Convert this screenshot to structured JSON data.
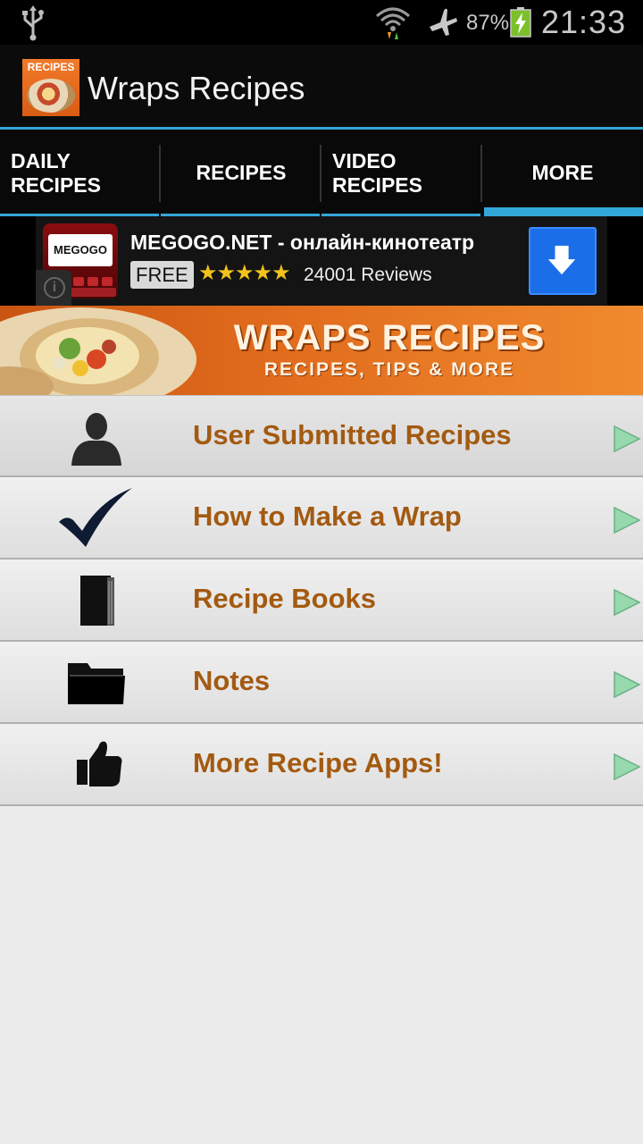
{
  "status_bar": {
    "battery_percent": "87%",
    "time": "21:33",
    "icons": [
      "usb-icon",
      "wifi-icon",
      "airplane-mode-icon",
      "battery-charging-icon"
    ]
  },
  "action_bar": {
    "app_icon_label": "RECIPES",
    "title": "Wraps Recipes",
    "accent_color": "#33a6d8"
  },
  "tabs": [
    {
      "label": "DAILY\nRECIPES",
      "selected": false
    },
    {
      "label": "RECIPES",
      "selected": false
    },
    {
      "label": "VIDEO\nRECIPES",
      "selected": false
    },
    {
      "label": "MORE",
      "selected": true
    }
  ],
  "ad": {
    "logo_text": "MEGOGO",
    "title": "MEGOGO.NET - онлайн-кинотеатр",
    "price_badge": "FREE",
    "rating": 4.5,
    "stars": "★★★★★",
    "reviews": "24001 Reviews",
    "download_color": "#1a6ee8"
  },
  "banner": {
    "title": "WRAPS RECIPES",
    "subtitle": "RECIPES, TIPS & MORE"
  },
  "menu": [
    {
      "label": "User Submitted Recipes",
      "icon": "user-icon"
    },
    {
      "label": "How to Make a Wrap",
      "icon": "checkmark-icon"
    },
    {
      "label": "Recipe Books",
      "icon": "book-icon"
    },
    {
      "label": "Notes",
      "icon": "folder-icon"
    },
    {
      "label": "More Recipe Apps!",
      "icon": "thumbs-up-icon"
    }
  ],
  "colors": {
    "menu_label": "#a35a10",
    "arrow": "#8fd6a8"
  }
}
